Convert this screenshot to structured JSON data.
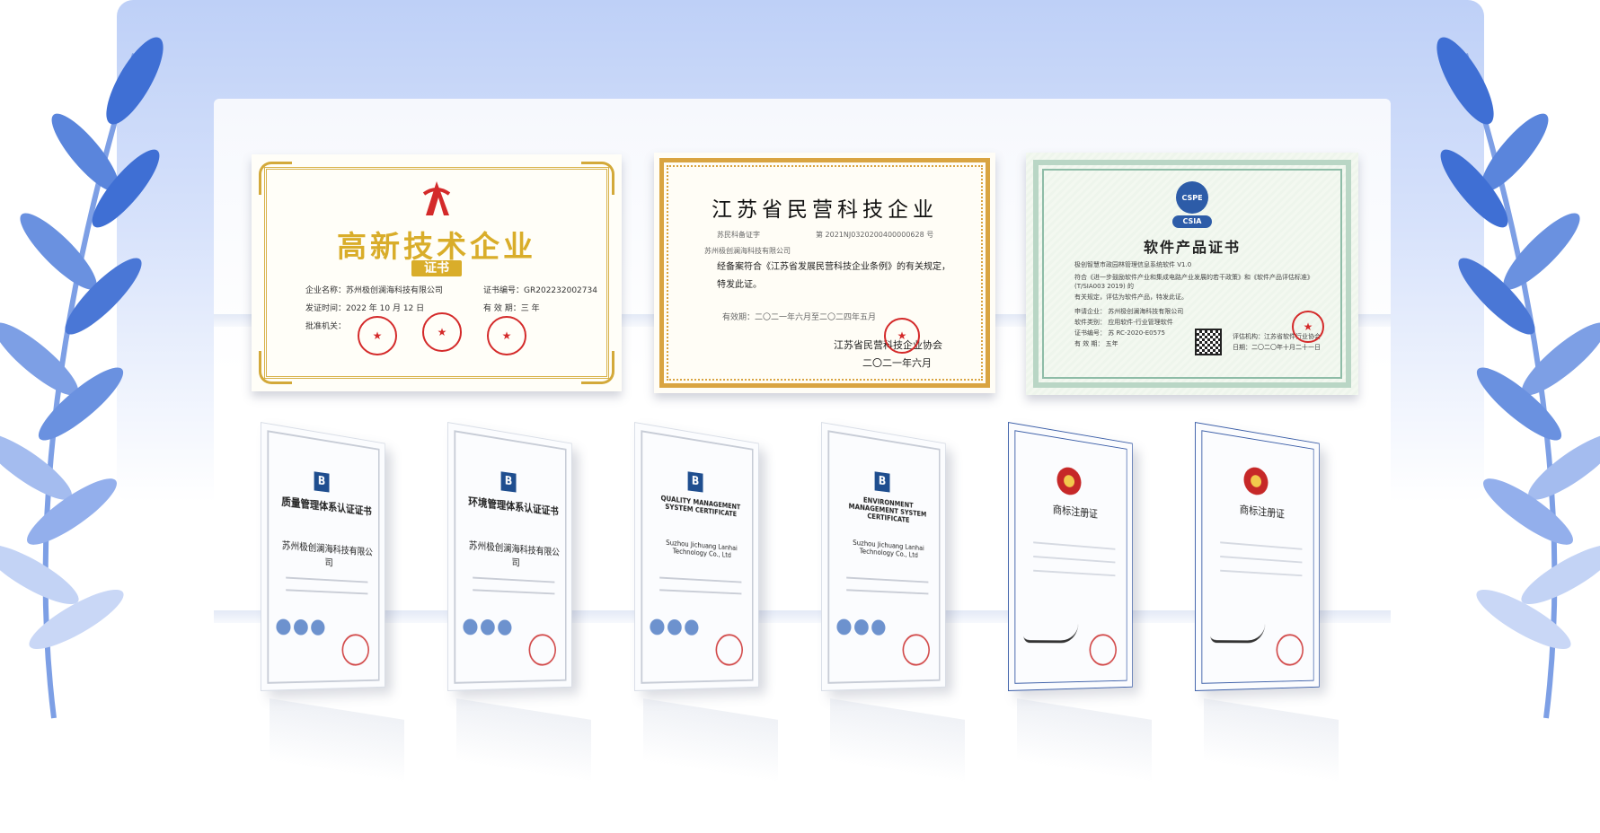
{
  "colors": {
    "backdrop_blue": "#bed0f7",
    "laurel_blue": "#4a77d6",
    "gold": "#d9ad2a",
    "seal_red": "#d42a2a"
  },
  "certificates_top": [
    {
      "title": "高新技术企业",
      "subtitle": "证书",
      "company_label": "企业名称：",
      "company": "苏州极创澜海科技有限公司",
      "cert_no_label": "证书编号：",
      "cert_no": "GR202232002734",
      "issue_label": "发证时间：",
      "issue_date": "2022 年 10 月 12 日",
      "valid_label": "有 效 期：",
      "valid": "三 年",
      "authority_label": "批准机关："
    },
    {
      "title": "江苏省民营科技企业",
      "record_label": "苏民科备证字",
      "record_no": "第 2021NJ0320200400000628 号",
      "company": "苏州极创澜海科技有限公司",
      "body": "经备案符合《江苏省发展民营科技企业条例》的有关规定，特发此证。",
      "valid": "有效期：二〇二一年六月至二〇二四年五月",
      "issuer": "江苏省民营科技企业协会",
      "date": "二〇二一年六月"
    },
    {
      "title": "软件产品证书",
      "badge_top": "CSPE",
      "badge_bottom": "CSIA",
      "lines": [
        "极创智慧市政园林管理信息系统软件 V1.0",
        "符合《进一步鼓励软件产业和集成电路产业发展的若干政策》和《软件产品评估标准》(T/SIA003 2019) 的",
        "有关规定，评估为软件产品，特发此证。",
        "申请企业：   苏州极创澜海科技有限公司",
        "软件类别：   应用软件-行业管理软件",
        "证书编号：   苏 RC-2020-E0575",
        "有 效 期：   五年"
      ],
      "org": "评估机构：江苏省软件行业协会",
      "date": "日期：二〇二〇年十月二十一日"
    }
  ],
  "certificates_bottom": [
    {
      "kind": "iso",
      "title": "质量管理体系认证证书",
      "company": "苏州极创澜海科技有限公司"
    },
    {
      "kind": "iso",
      "title": "环境管理体系认证证书",
      "company": "苏州极创澜海科技有限公司"
    },
    {
      "kind": "iso",
      "title": "QUALITY MANAGEMENT SYSTEM CERTIFICATE",
      "company": "Suzhou Jichuang Lanhai Technology Co., Ltd"
    },
    {
      "kind": "iso",
      "title": "ENVIRONMENT MANAGEMENT SYSTEM CERTIFICATE",
      "company": "Suzhou Jichuang Lanhai Technology Co., Ltd"
    },
    {
      "kind": "trademark",
      "title": "商标注册证",
      "company": ""
    },
    {
      "kind": "trademark",
      "title": "商标注册证",
      "company": ""
    }
  ]
}
